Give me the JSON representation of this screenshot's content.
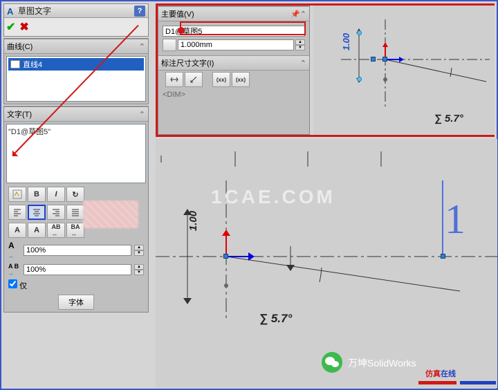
{
  "left": {
    "title": "草图文字",
    "curves_label": "曲线(C)",
    "curve_item": "直线4",
    "text_label": "文字(T)",
    "text_value": "\"D1@草图5\"",
    "pct1": "100%",
    "pct2": "100%",
    "font_btn": "字体",
    "checkbox_label": "仅"
  },
  "rt": {
    "main_value_label": "主要值(V)",
    "d1_value": "D1@草图5",
    "mm_value": "1.000mm",
    "dim_text_label": "标注尺寸文字(I)",
    "dim_placeholder": "<DIM>",
    "xx1": "(xx)",
    "xx2": "(xx)"
  },
  "view": {
    "dim_100_a": "1.00",
    "dim_100_b": "1.00",
    "angle_a": "∑ 5.7°",
    "angle_b": "∑ 5.7°",
    "watermark": "1CAE.COM",
    "big_number": "1",
    "wechat_text": "万坤SolidWorks",
    "brand_red": "仿真",
    "brand_blue": "在线"
  }
}
